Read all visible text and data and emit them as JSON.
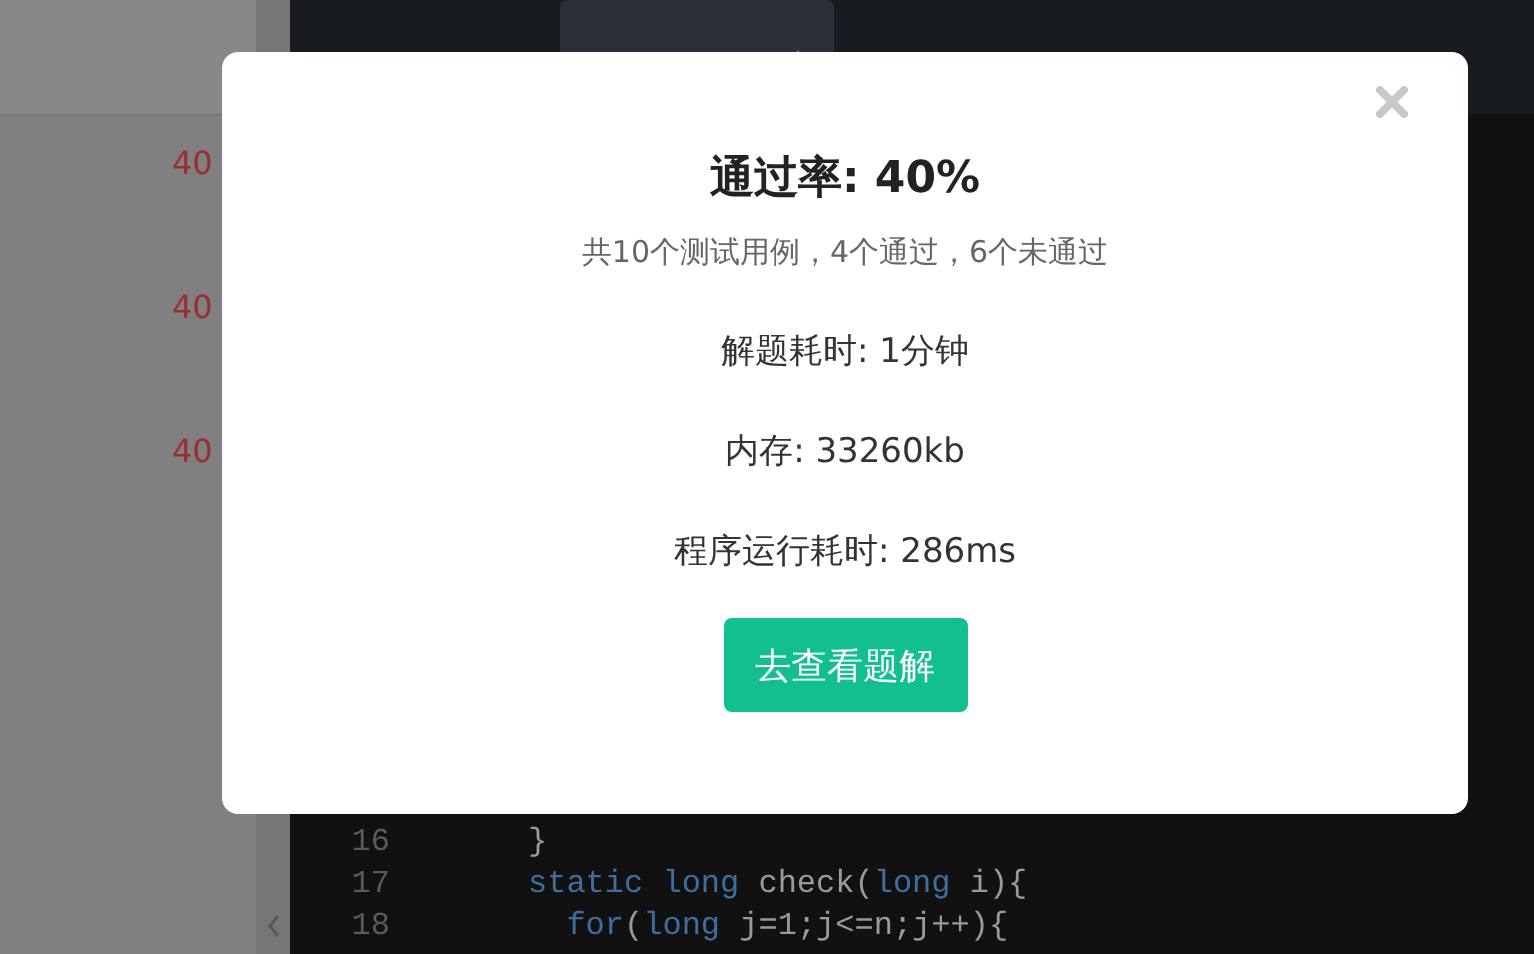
{
  "header": {
    "language_select": {
      "kind": "select"
    }
  },
  "results": [
    {
      "rate": "40"
    },
    {
      "rate": "40"
    },
    {
      "rate": "40"
    }
  ],
  "editor": {
    "lines": [
      {
        "number": "16",
        "tokens": [
          {
            "text": "}",
            "kind": "plain"
          }
        ]
      },
      {
        "number": "17",
        "tokens": [
          {
            "text": "static",
            "kind": "keyword"
          },
          {
            "text": " long",
            "kind": "keyword"
          },
          {
            "text": " check(",
            "kind": "plain"
          },
          {
            "text": "long",
            "kind": "keyword"
          },
          {
            "text": " i){",
            "kind": "plain"
          }
        ]
      },
      {
        "number": "18",
        "tokens": [
          {
            "text": "  for",
            "kind": "keyword"
          },
          {
            "text": "(",
            "kind": "plain"
          },
          {
            "text": "long",
            "kind": "keyword"
          },
          {
            "text": " j=1;j<=n;j++){",
            "kind": "plain"
          }
        ]
      }
    ]
  },
  "modal": {
    "title": "通过率: 40%",
    "summary": "共10个测试用例，4个通过，6个未通过",
    "stats": [
      "解题耗时: 1分钟",
      "内存: 33260kb",
      "程序运行耗时: 286ms"
    ],
    "button": "去查看题解"
  }
}
